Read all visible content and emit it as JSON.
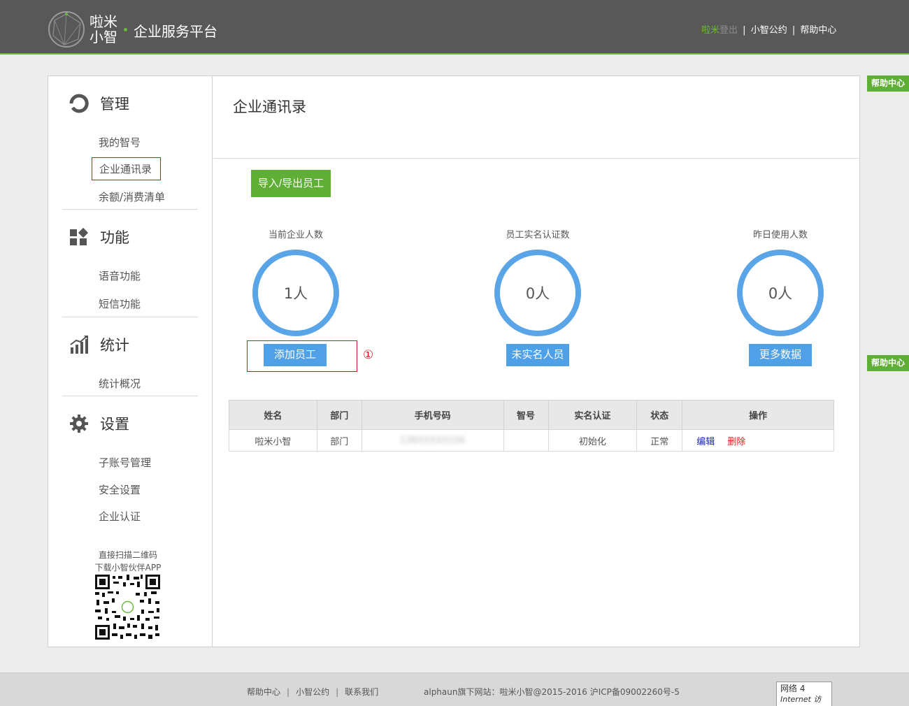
{
  "header": {
    "logo_text_line1": "啦米",
    "logo_text_line2": "小智",
    "platform_name": "企业服务平台",
    "link_user": "啦米",
    "link_logout": "登出",
    "sep": "|",
    "link_convention": "小智公约",
    "link_help": "帮助中心"
  },
  "help_tags": [
    "帮助中心",
    "帮助中心"
  ],
  "sidebar": {
    "sections": [
      {
        "title": "管理",
        "icon": "manage-icon",
        "items": [
          "我的智号",
          "企业通讯录",
          "余额/消费清单"
        ]
      },
      {
        "title": "功能",
        "icon": "function-icon",
        "items": [
          "语音功能",
          "短信功能"
        ]
      },
      {
        "title": "统计",
        "icon": "stats-icon",
        "items": [
          "统计概况"
        ]
      },
      {
        "title": "设置",
        "icon": "gear-icon",
        "items": [
          "子账号管理",
          "安全设置",
          "企业认证"
        ]
      }
    ],
    "active_item": "企业通讯录",
    "qr_text_line1": "直接扫描二维码",
    "qr_text_line2": "下载小智伙伴APP"
  },
  "main": {
    "title": "企业通讯录",
    "import_export_button": "导入/导出员工",
    "stats": [
      {
        "label": "当前企业人数",
        "value": "1人",
        "button": "添加员工"
      },
      {
        "label": "员工实名认证数",
        "value": "0人",
        "button": "未实名人员"
      },
      {
        "label": "昨日使用人数",
        "value": "0人",
        "button": "更多数据"
      }
    ],
    "annotation": "①",
    "table": {
      "headers": [
        "姓名",
        "部门",
        "手机号码",
        "智号",
        "实名认证",
        "状态",
        "操作"
      ],
      "rows": [
        {
          "name": "啦米小智",
          "dept": "部门",
          "phone": "138XXXX0106",
          "zhihao": "",
          "auth": "初始化",
          "status": "正常",
          "edit": "编辑",
          "delete": "删除"
        }
      ]
    }
  },
  "footer": {
    "links": [
      "帮助中心",
      "小智公约",
      "联系我们"
    ],
    "sep": "|",
    "copyright": "alphaun旗下网站：啦米小智@2015-2016 沪ICP备09002260号-5",
    "net_line1": "网络  4",
    "net_line2": "Internet 访问"
  },
  "colors": {
    "header_bg": "#585858",
    "brand_green": "#5fae35",
    "ring_blue": "#5aa4e8",
    "button_blue": "#4fa0e7",
    "highlight_red": "#d9141b"
  }
}
